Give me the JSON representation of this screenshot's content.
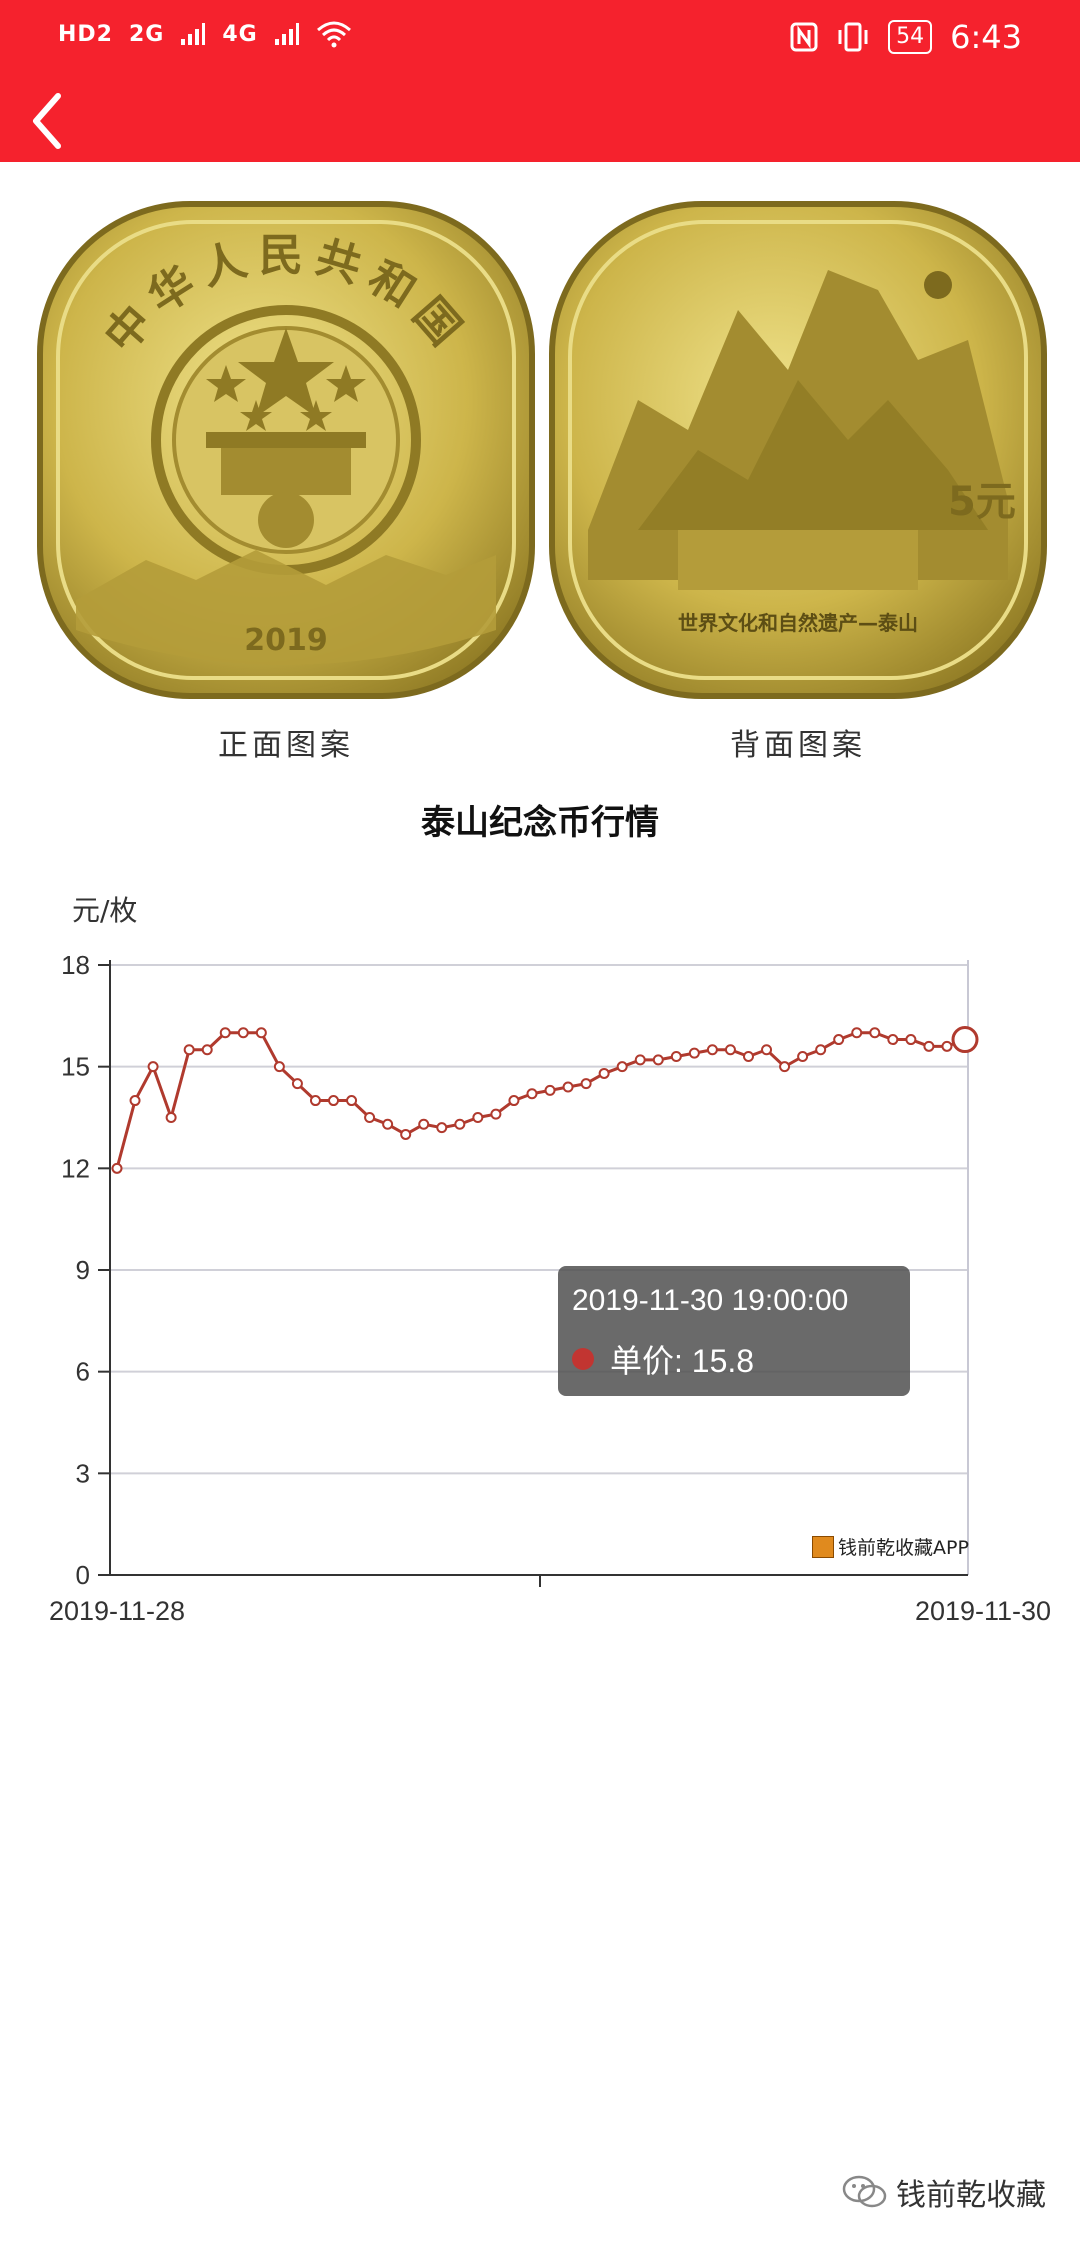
{
  "status_bar": {
    "signal_labels": [
      "HD2",
      "2G",
      "4G"
    ],
    "battery": "54",
    "time": "6:43"
  },
  "coins": {
    "front": {
      "inscription": "中华人民共和国",
      "year": "2019",
      "caption": "正面图案"
    },
    "back": {
      "denomination": "5元",
      "inscription": "世界文化和自然遗产—泰山",
      "caption": "背面图案"
    }
  },
  "chart_title": "泰山纪念币行情",
  "tooltip": {
    "time": "2019-11-30 19:00:00",
    "label": "单价: 15.8"
  },
  "chart_watermark": "钱前乾收藏APP",
  "footer_watermark": "钱前乾收藏",
  "colors": {
    "status_bar": "#f5222d",
    "line": "#b03a2e",
    "coin_gold": "#c9b24a"
  },
  "chart_data": {
    "type": "line",
    "ylabel": "元/枚",
    "ylim": [
      0,
      18
    ],
    "yticks": [
      "0",
      "3",
      "6",
      "9",
      "12",
      "15",
      "18"
    ],
    "x_labels": [
      "2019-11-28",
      "2019-11-30"
    ],
    "grid": true,
    "series": [
      {
        "name": "单价",
        "values": [
          12,
          14,
          15,
          13.5,
          15.5,
          15.5,
          16,
          16,
          16,
          15,
          14.5,
          14,
          14,
          14,
          13.5,
          13.3,
          13,
          13.3,
          13.2,
          13.3,
          13.5,
          13.6,
          14,
          14.2,
          14.3,
          14.4,
          14.5,
          14.8,
          15,
          15.2,
          15.2,
          15.3,
          15.4,
          15.5,
          15.5,
          15.3,
          15.5,
          15,
          15.3,
          15.5,
          15.8,
          16,
          16,
          15.8,
          15.8,
          15.6,
          15.6,
          15.8
        ]
      }
    ]
  }
}
